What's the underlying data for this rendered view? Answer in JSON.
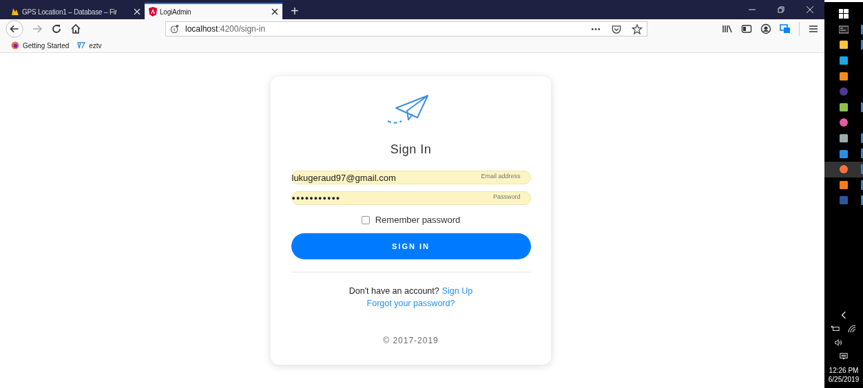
{
  "browser": {
    "tabs": [
      {
        "title": "GPS Location1 – Database – Fir",
        "selected": false
      },
      {
        "title": "LogiAdmin",
        "selected": true
      }
    ],
    "new_tab": "+",
    "url": {
      "host": "localhost",
      "rest": ":4200/sign-in"
    },
    "bookmarks": [
      {
        "label": "Getting Started"
      },
      {
        "label": "eztv"
      }
    ]
  },
  "card": {
    "title": "Sign In",
    "email": {
      "value": "lukugeraud97@gmail.com",
      "placeholder": "Email address"
    },
    "password": {
      "value": "●●●●●●●●●●●",
      "placeholder": "Password"
    },
    "remember": {
      "label": "Remember password",
      "checked": false
    },
    "submit": "SIGN IN",
    "signup_prompt": "Don't have an account?",
    "signup_link": "Sign Up",
    "forgot_link": "Forgot your password?",
    "footer": "© 2017-2019"
  },
  "taskbar": {
    "apps": [
      {
        "running": false,
        "selected": false
      },
      {
        "running": true,
        "selected": false
      },
      {
        "running": true,
        "selected": false
      },
      {
        "running": false,
        "selected": false
      },
      {
        "running": false,
        "selected": false
      },
      {
        "running": false,
        "selected": false
      },
      {
        "running": true,
        "selected": false
      },
      {
        "running": false,
        "selected": false
      },
      {
        "running": true,
        "selected": false
      },
      {
        "running": true,
        "selected": false
      },
      {
        "running": true,
        "selected": true
      },
      {
        "running": true,
        "selected": false
      },
      {
        "running": true,
        "selected": false
      }
    ],
    "time": "12:26 PM",
    "date": "6/25/2019"
  }
}
